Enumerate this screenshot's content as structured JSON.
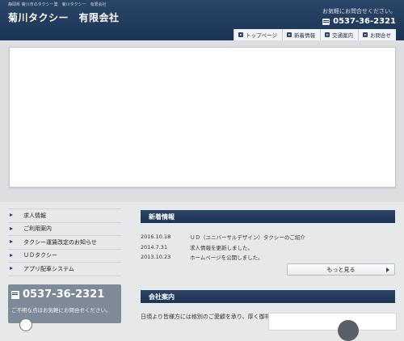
{
  "header": {
    "tagline": "静岡県 菊川市のタクシー業　菊川タクシー　有限会社",
    "company": "菊川タクシー　有限会社",
    "contact_note": "お気軽にお問合せください。",
    "phone": "0537-36-2321"
  },
  "nav": [
    {
      "label": "トップページ",
      "icon": "arrow-right-icon"
    },
    {
      "label": "新着情報",
      "icon": "arrow-right-icon"
    },
    {
      "label": "交通案内",
      "icon": "arrow-right-icon"
    },
    {
      "label": "お問合せ",
      "icon": "arrow-right-icon"
    }
  ],
  "sidebar": {
    "items": [
      {
        "label": "求人情報"
      },
      {
        "label": "ご利用案内"
      },
      {
        "label": "タクシー運賃改定のお知らせ"
      },
      {
        "label": "ＵＤタクシー"
      },
      {
        "label": "アプリ配車システム"
      }
    ],
    "call_box": {
      "phone": "0537-36-2321",
      "note": "ご不明な点はお気軽にお問合せください。"
    }
  },
  "news": {
    "heading": "新着情報",
    "items": [
      {
        "date": "2016.10.18",
        "text": "ＵＤ（ユニバーサルデザイン）タクシーのご紹介"
      },
      {
        "date": "2014.7.31",
        "text": "求人情報を更新しました。"
      },
      {
        "date": "2013.10.23",
        "text": "ホームページを公開しました。"
      }
    ],
    "more_label": "もっと見る"
  },
  "about": {
    "heading": "会社案内",
    "text": "日頃より皆様方には格別のご愛顧を承り、厚く御礼"
  },
  "colors": {
    "header_bg": "#1f3a5f",
    "accent": "#2b4568",
    "page_bg": "#e7e8ea"
  }
}
